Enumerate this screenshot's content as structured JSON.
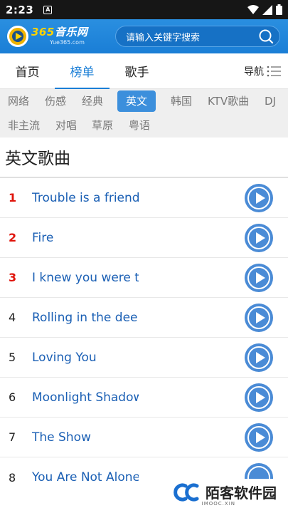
{
  "status_bar": {
    "time": "2:23",
    "notification_glyph": "A"
  },
  "header": {
    "logo_number": "365",
    "logo_name": "音乐网",
    "logo_url": "Yue365.com",
    "search_placeholder": "请输入关键字搜索",
    "brand_color": "#1a7ed6"
  },
  "nav": {
    "tabs": [
      {
        "label": "首页",
        "active": false
      },
      {
        "label": "榜单",
        "active": true
      },
      {
        "label": "歌手",
        "active": false
      }
    ],
    "guide_label": "导航"
  },
  "categories": {
    "row1": [
      "网络",
      "伤感",
      "经典",
      "英文",
      "韩国",
      "KTV歌曲",
      "DJ"
    ],
    "row2": [
      "非主流",
      "对唱",
      "草原",
      "粤语"
    ],
    "active": "英文"
  },
  "section": {
    "title": "英文歌曲"
  },
  "songs": [
    {
      "rank": "1",
      "title": "Trouble is a friend",
      "top": true
    },
    {
      "rank": "2",
      "title": "Fire",
      "top": true
    },
    {
      "rank": "3",
      "title": "I knew you were tr",
      "top": true
    },
    {
      "rank": "4",
      "title": "Rolling in the deep",
      "top": false
    },
    {
      "rank": "5",
      "title": "Loving You",
      "top": false
    },
    {
      "rank": "6",
      "title": "Moonlight Shadow",
      "top": false
    },
    {
      "rank": "7",
      "title": "The Show",
      "top": false
    },
    {
      "rank": "8",
      "title": "You Are Not Alone",
      "top": false
    }
  ],
  "watermark": {
    "text": "陌客软件园",
    "sub": "IMOOC.XIN"
  }
}
